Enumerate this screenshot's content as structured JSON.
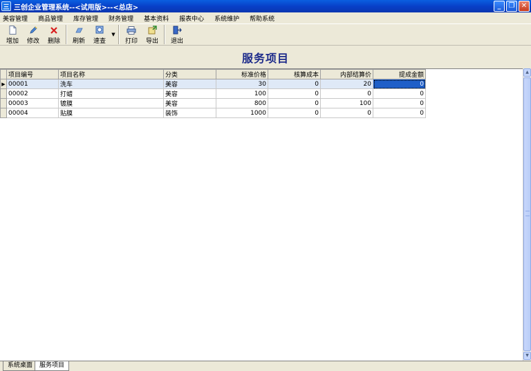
{
  "window": {
    "title": "三创企业管理系统--<试用版>--<总店>",
    "app_icon": "三"
  },
  "menu": [
    "美容管理",
    "商品管理",
    "库存管理",
    "财务管理",
    "基本资料",
    "报表中心",
    "系统维护",
    "帮助系统"
  ],
  "toolbar": {
    "add": "增加",
    "edit": "修改",
    "delete": "删除",
    "refresh": "刷新",
    "quick_search": "速查",
    "print": "打印",
    "export": "导出",
    "exit": "退出"
  },
  "page_title": "服务项目",
  "grid": {
    "columns": [
      "项目编号",
      "项目名称",
      "分类",
      "标准价格",
      "核算成本",
      "内部结算价",
      "提成金额"
    ],
    "rows": [
      [
        "00001",
        "洗车",
        "美容",
        "30",
        "0",
        "20",
        "0"
      ],
      [
        "00002",
        "打蜡",
        "美容",
        "100",
        "0",
        "0",
        "0"
      ],
      [
        "00003",
        "镀膜",
        "美容",
        "800",
        "0",
        "100",
        "0"
      ],
      [
        "00004",
        "贴膜",
        "装饰",
        "1000",
        "0",
        "0",
        "0"
      ]
    ]
  },
  "tabs": [
    "系统桌面",
    "服务项目"
  ],
  "colors": {
    "titlebar": "#0840c8",
    "selection": "#1f5fc8",
    "title_text": "#1c2a8a"
  }
}
